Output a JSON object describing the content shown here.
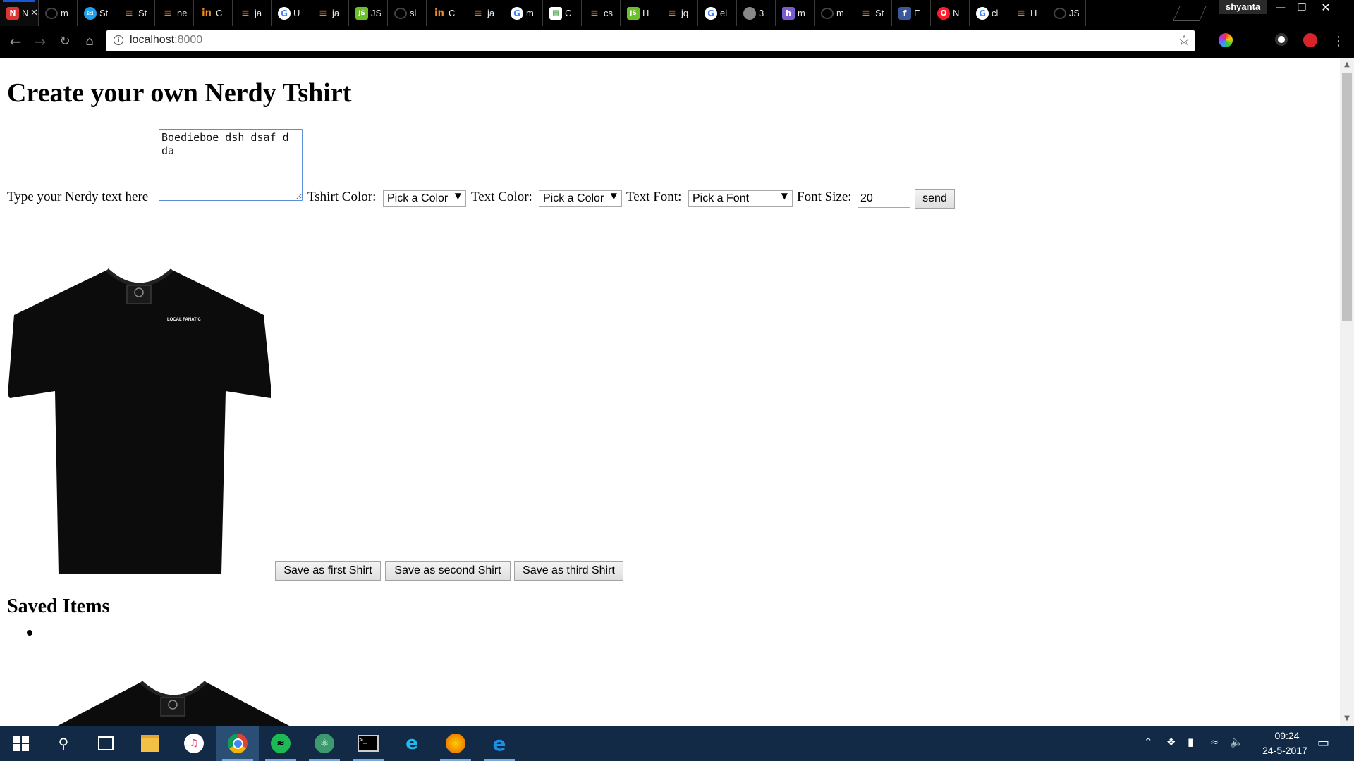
{
  "browser": {
    "tabs": [
      {
        "icon": "notepad-icon",
        "title": "Ne",
        "active": true
      },
      {
        "icon": "github-icon",
        "title": "m"
      },
      {
        "icon": "twitter-icon",
        "title": "St"
      },
      {
        "icon": "stackoverflow-icon",
        "title": "St"
      },
      {
        "icon": "stackoverflow-icon",
        "title": "ne"
      },
      {
        "icon": "linkedin-icon",
        "title": "C"
      },
      {
        "icon": "stackoverflow-icon",
        "title": "ja"
      },
      {
        "icon": "google-icon",
        "title": "U"
      },
      {
        "icon": "stackoverflow-icon",
        "title": "ja"
      },
      {
        "icon": "jsbin-icon",
        "title": "JS"
      },
      {
        "icon": "github-icon",
        "title": "sl"
      },
      {
        "icon": "linkedin-icon",
        "title": "C"
      },
      {
        "icon": "stackoverflow-icon",
        "title": "ja"
      },
      {
        "icon": "google-icon",
        "title": "m"
      },
      {
        "icon": "chart-icon",
        "title": "C"
      },
      {
        "icon": "stackoverflow-icon",
        "title": "cs"
      },
      {
        "icon": "jsbin-icon",
        "title": "H"
      },
      {
        "icon": "stackoverflow-icon",
        "title": "jq"
      },
      {
        "icon": "google-icon",
        "title": "el"
      },
      {
        "icon": "octocat-icon",
        "title": "3"
      },
      {
        "icon": "hackster-icon",
        "title": "m"
      },
      {
        "icon": "github-icon",
        "title": "m"
      },
      {
        "icon": "stackoverflow-icon",
        "title": "St"
      },
      {
        "icon": "facebook-icon",
        "title": "E"
      },
      {
        "icon": "opera-icon",
        "title": "N"
      },
      {
        "icon": "google-icon",
        "title": "cl"
      },
      {
        "icon": "stackoverflow-icon",
        "title": "H"
      },
      {
        "icon": "github-icon",
        "title": "JS"
      }
    ],
    "profile_name": "shyanta",
    "url_host": "localhost",
    "url_port": ":8000"
  },
  "page": {
    "heading": "Create your own Nerdy Tshirt",
    "textarea_label": "Type your Nerdy text here",
    "textarea_value": "Boedieboe dsh dsaf d\nda",
    "tshirt_color_label": "Tshirt Color:",
    "tshirt_color_value": "Pick a Color",
    "text_color_label": "Text Color:",
    "text_color_value": "Pick a Color",
    "text_font_label": "Text Font:",
    "text_font_value": "Pick a Font",
    "font_size_label": "Font Size:",
    "font_size_value": "20",
    "send_label": "send",
    "tshirt_print_text": "LOCAL FANATIC",
    "save_first_label": "Save as first Shirt",
    "save_second_label": "Save as second Shirt",
    "save_third_label": "Save as third Shirt",
    "saved_heading": "Saved Items"
  },
  "taskbar": {
    "apps": [
      "start-icon",
      "search-icon",
      "task-view-icon",
      "file-explorer-icon",
      "itunes-icon",
      "chrome-icon",
      "spotify-icon",
      "atom-icon",
      "terminal-icon",
      "internet-explorer-icon",
      "firefox-icon",
      "edge-icon"
    ],
    "time": "09:24",
    "date": "24-5-2017"
  },
  "colors": {
    "tab_accent": "#1a56d6",
    "taskbar": "#122a46",
    "tshirt": "#0c0c0c",
    "textarea_border": "#5b8dd9"
  }
}
